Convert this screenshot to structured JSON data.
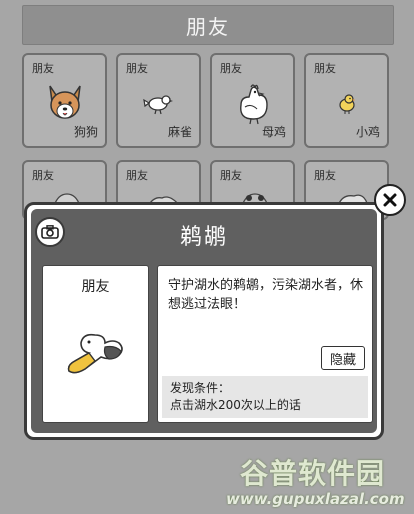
{
  "header": {
    "title": "朋友"
  },
  "grid": {
    "cards": [
      {
        "tag": "朋友",
        "name": "狗狗",
        "icon": "dog-icon"
      },
      {
        "tag": "朋友",
        "name": "麻雀",
        "icon": "sparrow-icon"
      },
      {
        "tag": "朋友",
        "name": "母鸡",
        "icon": "hen-icon"
      },
      {
        "tag": "朋友",
        "name": "小鸡",
        "icon": "chick-icon"
      },
      {
        "tag": "朋友",
        "name": "",
        "icon": "animal-icon"
      },
      {
        "tag": "朋友",
        "name": "",
        "icon": "animal-icon"
      },
      {
        "tag": "朋友",
        "name": "",
        "icon": "animal-icon"
      },
      {
        "tag": "朋友",
        "name": "",
        "icon": "animal-icon"
      }
    ]
  },
  "modal": {
    "title": "鹈鹕",
    "camera_icon": "camera-icon",
    "close_icon": "close-icon",
    "card_tag": "朋友",
    "art_icon": "pelican-icon",
    "description": "守护湖水的鹈鹕，污染湖水者，休想逃过法眼！",
    "hide_label": "隐藏",
    "condition_title": "发现条件：",
    "condition_text": "点击湖水200次以上的话"
  },
  "watermark": {
    "title": "谷普软件园",
    "url": "www.gupuxlazal.com"
  }
}
